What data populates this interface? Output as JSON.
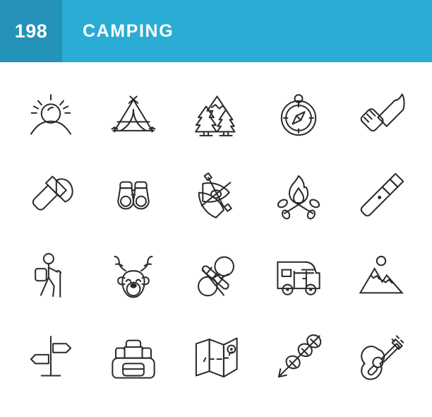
{
  "header": {
    "count": "198",
    "title": "CAMPING",
    "count_bg": "#2593b9",
    "title_bg": "#2bacd4",
    "text_color": "#ffffff"
  },
  "canvas": {
    "background": "#ffffff",
    "icon_stroke": "#2b2b2b"
  },
  "grid": {
    "columns": 5,
    "rows": 4,
    "icons": [
      {
        "name": "sunrise-icon",
        "label": "Sunrise"
      },
      {
        "name": "tent-icon",
        "label": "Tent"
      },
      {
        "name": "forest-icon",
        "label": "Forest"
      },
      {
        "name": "compass-icon",
        "label": "Compass"
      },
      {
        "name": "knife-icon",
        "label": "Knife"
      },
      {
        "name": "axe-icon",
        "label": "Axe"
      },
      {
        "name": "binoculars-icon",
        "label": "Binoculars"
      },
      {
        "name": "kayak-icon",
        "label": "Kayak"
      },
      {
        "name": "campfire-icon",
        "label": "Campfire"
      },
      {
        "name": "flashlight-icon",
        "label": "Flashlight"
      },
      {
        "name": "hiker-icon",
        "label": "Hiker"
      },
      {
        "name": "deer-icon",
        "label": "Deer"
      },
      {
        "name": "rope-icon",
        "label": "Rope"
      },
      {
        "name": "camper-van-icon",
        "label": "Camper Van"
      },
      {
        "name": "mountains-icon",
        "label": "Mountains"
      },
      {
        "name": "signpost-icon",
        "label": "Signpost"
      },
      {
        "name": "backpack-icon",
        "label": "Backpack"
      },
      {
        "name": "map-icon",
        "label": "Map"
      },
      {
        "name": "marshmallow-skewer-icon",
        "label": "Marshmallow Skewer"
      },
      {
        "name": "guitar-icon",
        "label": "Guitar"
      }
    ]
  }
}
